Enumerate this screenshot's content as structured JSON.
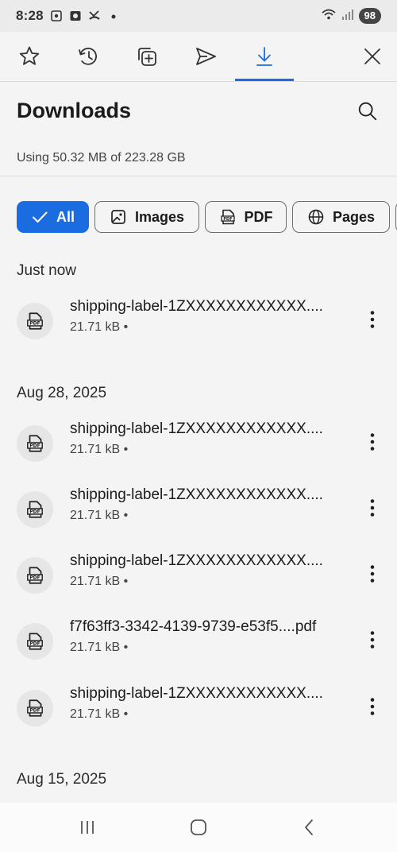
{
  "status_bar": {
    "time": "8:28",
    "battery": "98"
  },
  "toolbar": {
    "items": [
      {
        "name": "favorites",
        "icon": "star-icon",
        "active": false
      },
      {
        "name": "history",
        "icon": "history-icon",
        "active": false
      },
      {
        "name": "collections",
        "icon": "collections-icon",
        "active": false
      },
      {
        "name": "share",
        "icon": "send-icon",
        "active": false
      },
      {
        "name": "downloads",
        "icon": "download-icon",
        "active": true
      }
    ],
    "close_icon": "close-icon",
    "accent": "#1a6ce0"
  },
  "header": {
    "title": "Downloads",
    "usage": "Using 50.32 MB of 223.28 GB",
    "search_icon": "search-icon"
  },
  "filters": [
    {
      "label": "All",
      "icon": "check-icon",
      "selected": true
    },
    {
      "label": "Images",
      "icon": "image-icon",
      "selected": false
    },
    {
      "label": "PDF",
      "icon": "pdf-icon",
      "selected": false
    },
    {
      "label": "Pages",
      "icon": "globe-icon",
      "selected": false
    }
  ],
  "sections": [
    {
      "date": "Just now",
      "items": [
        {
          "name": "shipping-label-1ZXXXXXXXXXXXX....",
          "meta": "21.71 kB •"
        }
      ]
    },
    {
      "date": "Aug 28, 2025",
      "items": [
        {
          "name": "shipping-label-1ZXXXXXXXXXXXX....",
          "meta": "21.71 kB •"
        },
        {
          "name": "shipping-label-1ZXXXXXXXXXXXX....",
          "meta": "21.71 kB •"
        },
        {
          "name": "shipping-label-1ZXXXXXXXXXXXX....",
          "meta": "21.71 kB •"
        },
        {
          "name": "f7f63ff3-3342-4139-9739-e53f5....pdf",
          "meta": "21.71 kB •"
        },
        {
          "name": "shipping-label-1ZXXXXXXXXXXXX....",
          "meta": "21.71 kB •"
        }
      ]
    },
    {
      "date": "Aug 15, 2025",
      "items": []
    }
  ]
}
